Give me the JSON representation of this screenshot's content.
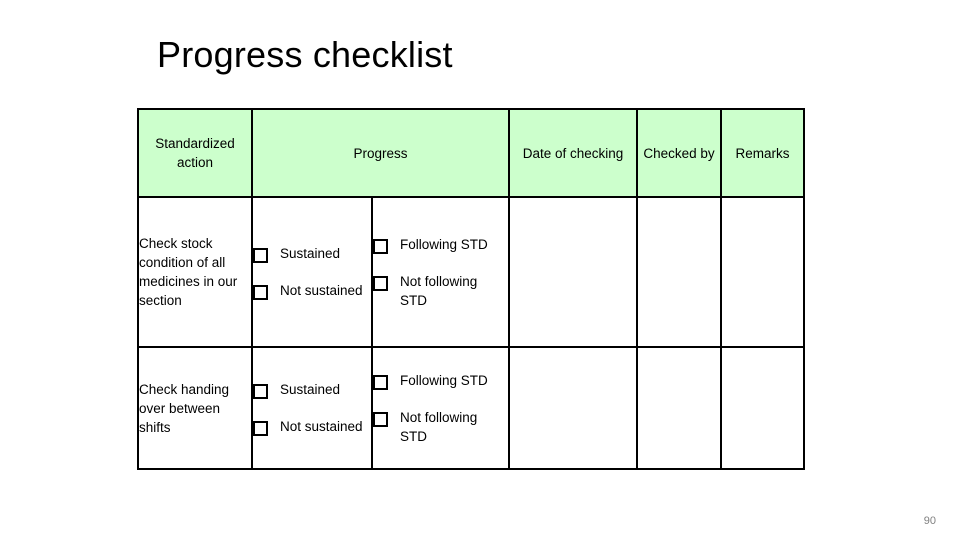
{
  "slide": {
    "title": "Progress checklist",
    "page_number": "90",
    "header_fill": "#ccffcc",
    "border_color": "#000000",
    "page_number_color": "#808080"
  },
  "table": {
    "headers": [
      {
        "label": "Standardized action",
        "name": "standardized-action"
      },
      {
        "label": "Progress",
        "name": "progress"
      },
      {
        "label": "Date of checking",
        "name": "date-of-checking"
      },
      {
        "label": "Checked by",
        "name": "checked-by"
      },
      {
        "label": "Remarks",
        "name": "remarks"
      }
    ],
    "rows": [
      {
        "action": "Check stock condition of all medicines in our section",
        "progress_a": [
          {
            "checkbox": "checkbox-icon",
            "label": "Sustained",
            "checked": false
          },
          {
            "checkbox": "checkbox-icon",
            "label": "Not sustained",
            "checked": false
          }
        ],
        "progress_b": [
          {
            "checkbox": "checkbox-icon",
            "label": "Following STD",
            "checked": false
          },
          {
            "checkbox": "checkbox-icon",
            "label": "Not following STD",
            "checked": false
          }
        ],
        "date_of_checking": "",
        "checked_by": "",
        "remarks": ""
      },
      {
        "action": "Check handing over between shifts",
        "progress_a": [
          {
            "checkbox": "checkbox-icon",
            "label": "Sustained",
            "checked": false
          },
          {
            "checkbox": "checkbox-icon",
            "label": "Not sustained",
            "checked": false
          }
        ],
        "progress_b": [
          {
            "checkbox": "checkbox-icon",
            "label": "Following STD",
            "checked": false
          },
          {
            "checkbox": "checkbox-icon",
            "label": "Not following STD",
            "checked": false
          }
        ],
        "date_of_checking": "",
        "checked_by": "",
        "remarks": ""
      }
    ]
  }
}
